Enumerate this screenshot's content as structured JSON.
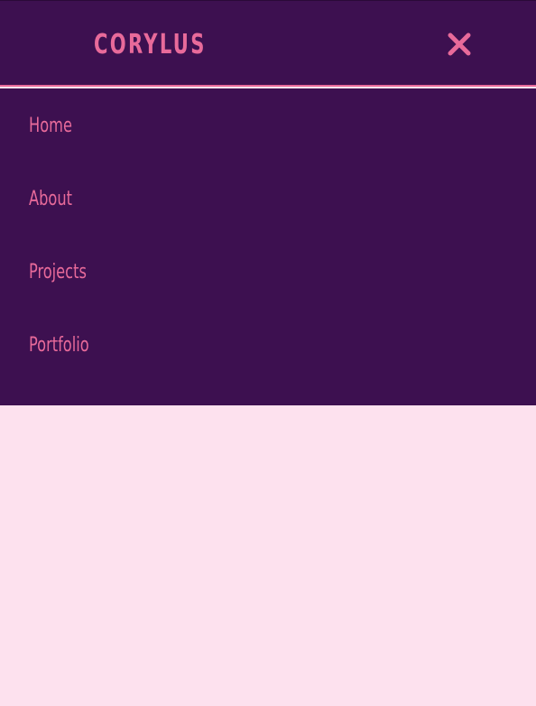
{
  "header": {
    "brand": "CORYLUS",
    "close_icon": "close-icon"
  },
  "menu": {
    "items": [
      {
        "label": "Home"
      },
      {
        "label": "About"
      },
      {
        "label": "Projects"
      },
      {
        "label": "Portfolio"
      }
    ]
  },
  "colors": {
    "nav_background": "#3d1050",
    "accent": "#e86a9a",
    "page_background": "#fde1ee"
  }
}
